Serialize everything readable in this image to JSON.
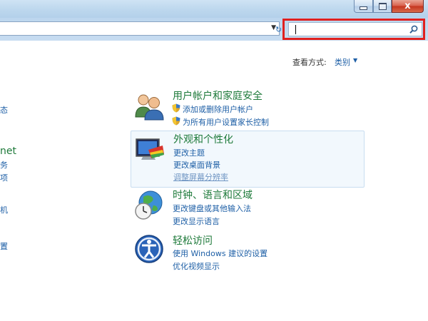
{
  "window": {
    "close_glyph": "x"
  },
  "search": {
    "placeholder": ""
  },
  "view_by": {
    "label": "查看方式:",
    "value": "类别"
  },
  "left_panel": [
    "态",
    "net",
    "务",
    "项",
    "机",
    "置"
  ],
  "categories": [
    {
      "title": "用户帐户和家庭安全",
      "icon": "users-icon",
      "links": [
        "添加或删除用户帐户",
        "为所有用户设置家长控制"
      ]
    },
    {
      "title": "外观和个性化",
      "icon": "monitor-palette-icon",
      "links": [
        "更改主题",
        "更改桌面背景",
        "调整屏幕分辨率"
      ]
    },
    {
      "title": "时钟、语言和区域",
      "icon": "globe-clock-icon",
      "links": [
        "更改键盘或其他输入法",
        "更改显示语言"
      ]
    },
    {
      "title": "轻松访问",
      "icon": "ease-of-access-icon",
      "links": [
        "使用 Windows 建议的设置",
        "优化视频显示"
      ]
    }
  ],
  "colors": {
    "highlight": "#e0201f",
    "link": "#1e5fa6",
    "category_title": "#1e7a3a"
  }
}
